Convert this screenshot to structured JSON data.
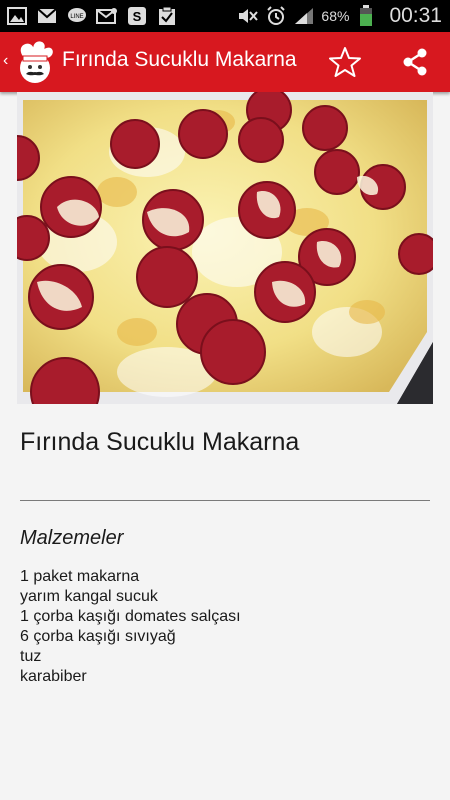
{
  "status_bar": {
    "battery_percent": "68%",
    "time": "00:31",
    "left_icons": [
      "gallery-icon",
      "gmail-icon",
      "line-icon",
      "email-icon",
      "skype-icon",
      "clipboard-check-icon"
    ],
    "right_icons": [
      "mute-icon",
      "alarm-icon",
      "signal-icon",
      "battery-icon"
    ]
  },
  "action_bar": {
    "title": "Fırında Sucuklu Makarna",
    "background_color": "#d7181f",
    "logo_icon": "chef-hat-logo-icon",
    "favorite_icon": "star-outline-icon",
    "share_icon": "share-icon"
  },
  "recipe": {
    "photo_alt": "Fırında Sucuklu Makarna",
    "title": "Fırında Sucuklu Makarna",
    "section_heading": "Malzemeler",
    "ingredients": [
      "1 paket makarna",
      "yarım kangal sucuk",
      "1 çorba kaşığı domates salçası",
      "6 çorba kaşığı sıvıyağ",
      "tuz",
      "karabiber"
    ]
  }
}
